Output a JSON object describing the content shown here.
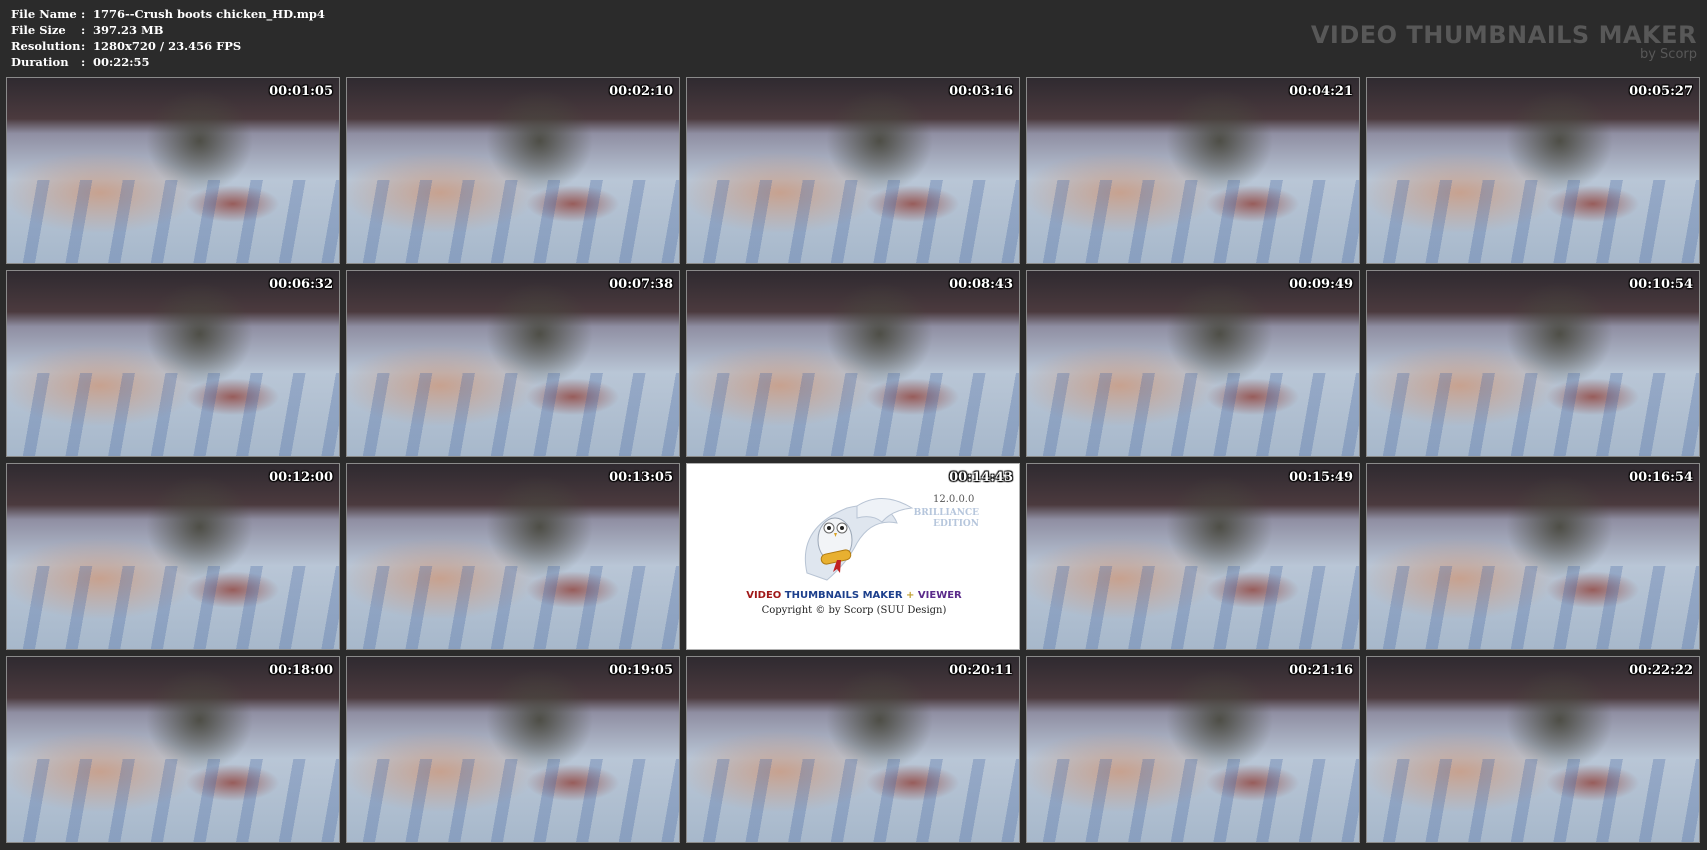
{
  "info": [
    {
      "label": "File Name",
      "sep": ":",
      "value": "1776--Crush boots chicken_HD.mp4"
    },
    {
      "label": "File Size",
      "sep": ":",
      "value": "397.23 MB"
    },
    {
      "label": "Resolution",
      "sep": ":",
      "value": "1280x720 / 23.456 FPS"
    },
    {
      "label": "Duration",
      "sep": ":",
      "value": "00:22:55"
    }
  ],
  "brand": {
    "title": "VIDEO THUMBNAILS MAKER",
    "subtitle": "by Scorp"
  },
  "thumbnails": [
    "00:01:05",
    "00:02:10",
    "00:03:16",
    "00:04:21",
    "00:05:27",
    "00:06:32",
    "00:07:38",
    "00:08:43",
    "00:09:49",
    "00:10:54",
    "00:12:00",
    "00:13:05",
    "00:14:43",
    "00:15:49",
    "00:16:54",
    "00:18:00",
    "00:19:05",
    "00:20:11",
    "00:21:16",
    "00:22:22"
  ],
  "splash": {
    "version": "12.0.0.0",
    "edition_line1": "BRILLIANCE",
    "edition_line2": "EDITION",
    "name_part1": "VIDEO",
    "name_part2": "THUMBNAILS MAKER",
    "name_part3": "+",
    "name_part4": "VIEWER",
    "copyright": "Copyright © by Scorp (SUU Design)"
  }
}
